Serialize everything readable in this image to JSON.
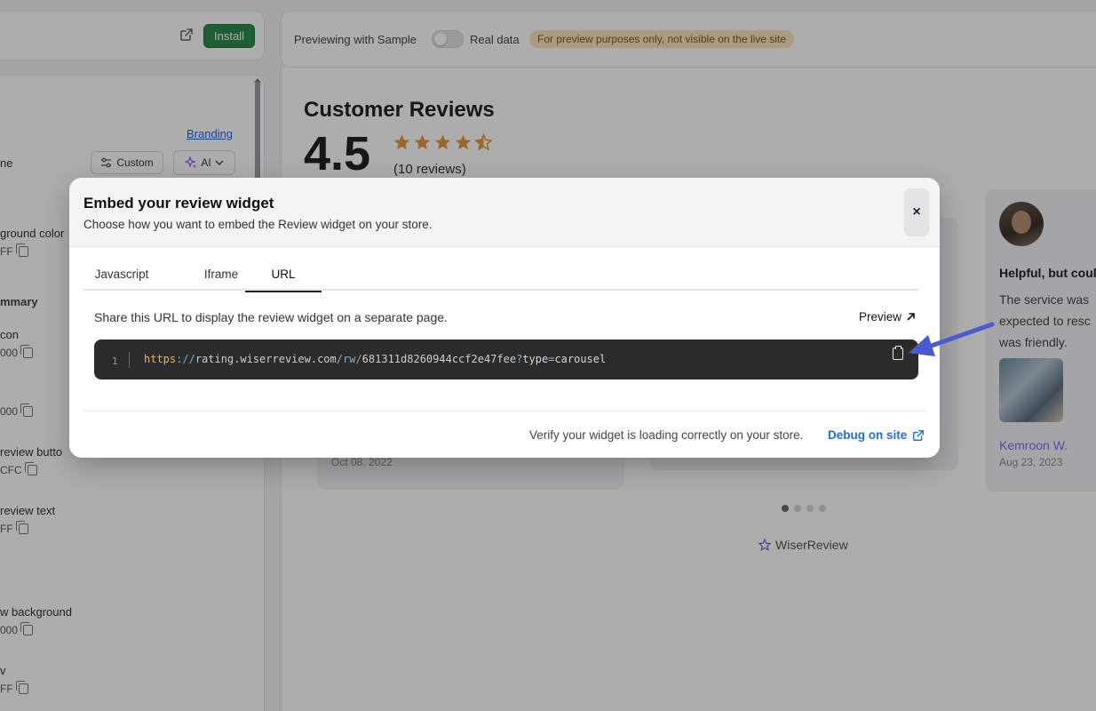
{
  "header": {
    "install_label": "Install",
    "preview_with": "Previewing with Sample",
    "real_data": "Real data",
    "preview_badge": "For preview purposes only, not visible on the live site"
  },
  "left_panel": {
    "branding_link": "Branding",
    "custom_btn": "Custom",
    "ai_btn": "AI",
    "labels": [
      {
        "label": "ne",
        "value": ""
      },
      {
        "label": "ground color",
        "value": "FF"
      },
      {
        "label": "mmary",
        "value": ""
      },
      {
        "label": "con",
        "value": "000"
      },
      {
        "label": "",
        "value": "000"
      },
      {
        "label": "review butto",
        "value": "CFC"
      },
      {
        "label": "review text",
        "value": "FF"
      },
      {
        "label": "w background",
        "value": "000"
      },
      {
        "label": "v",
        "value": "FF"
      }
    ]
  },
  "preview": {
    "title": "Customer Reviews",
    "rating": "4.5",
    "reviews_count": "(10 reviews)",
    "card_date": "Oct 08, 2022",
    "review_title": "Helpful, but coul",
    "review_text": "The service was expected to resc was friendly.",
    "reviewer_name": "Kemroon W.",
    "review_date": "Aug 23, 2023",
    "brand": "WiserReview",
    "star_color": "#e8963c"
  },
  "modal": {
    "title": "Embed your review widget",
    "subtitle": "Choose how you want to embed the Review widget on your store.",
    "close_label": "×",
    "tabs": [
      {
        "label": "Javascript"
      },
      {
        "label": "Iframe"
      },
      {
        "label": "URL",
        "active": true
      }
    ],
    "share_text": "Share this URL to display the review widget on a separate page.",
    "preview_label": "Preview",
    "code": {
      "line_number": "1",
      "proto": "https",
      "sep": "://",
      "host": "rating.wiserreview.com",
      "path": "/rw/",
      "id": "681311d8260944ccf2e47fee",
      "q": "?",
      "key": "type",
      "eq": "=",
      "val": "carousel"
    },
    "verify_text": "Verify your widget is loading correctly on your store.",
    "debug_label": "Debug on site"
  },
  "colors": {
    "install_green": "#2f8a4e",
    "link_blue": "#1d6fd8",
    "arrow_blue": "#4a5bd1",
    "code_bg": "#2b2b2b"
  }
}
